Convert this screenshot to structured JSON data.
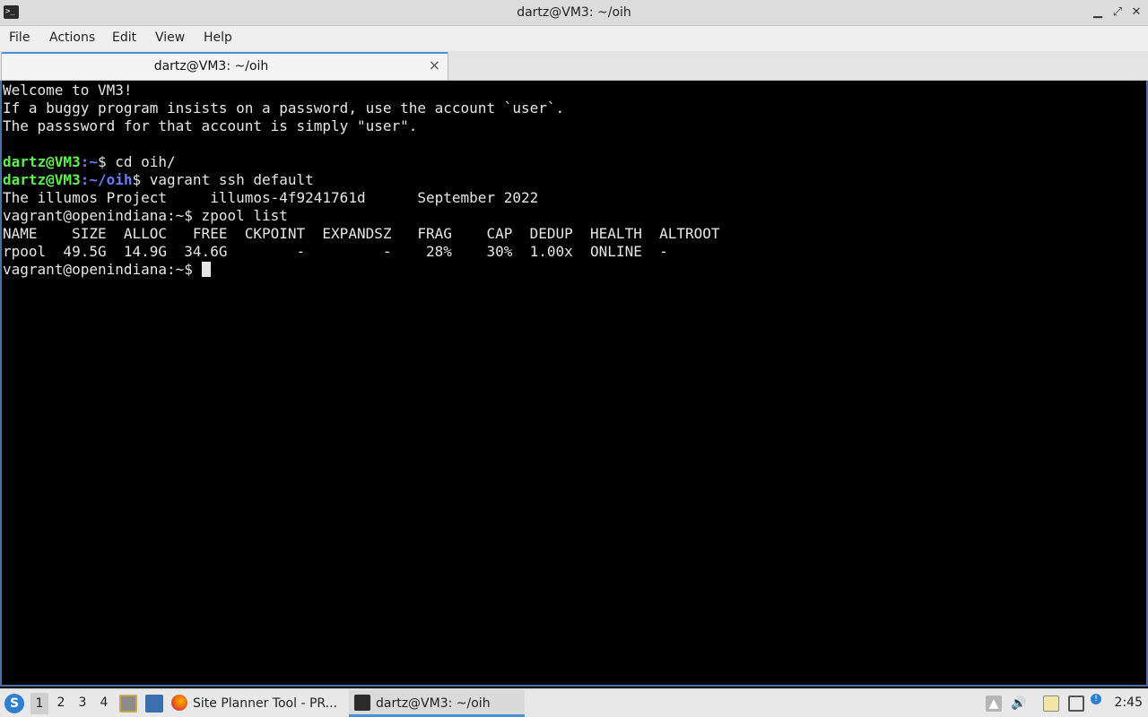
{
  "window": {
    "title": "dartz@VM3: ~/oih",
    "minimize": "▁",
    "maximize": "⤢",
    "close": "✕"
  },
  "menu": [
    "File",
    "Actions",
    "Edit",
    "View",
    "Help"
  ],
  "tab": {
    "label": "dartz@VM3: ~/oih",
    "close": "×"
  },
  "terminal": {
    "motd1": "Welcome to VM3!",
    "motd2": "If a buggy program insists on a password, use the account `user`.",
    "motd3": "The passsword for that account is simply \"user\".",
    "p1_user": "dartz@VM3",
    "p1_path": ":~",
    "p1_cmd": "$ cd oih/",
    "p2_user": "dartz@VM3",
    "p2_path": ":~/oih",
    "p2_cmd": "$ vagrant ssh default",
    "banner": "The illumos Project     illumos-4f9241761d      September 2022",
    "cmd_zpool": "vagrant@openindiana:~$ zpool list",
    "zpool_header": "NAME    SIZE  ALLOC   FREE  CKPOINT  EXPANDSZ   FRAG    CAP  DEDUP  HEALTH  ALTROOT",
    "zpool_row": "rpool  49.5G  14.9G  34.6G        -         -    28%    30%  1.00x  ONLINE  -",
    "prompt_final": "vagrant@openindiana:~$ "
  },
  "taskbar": {
    "start_icon": "start-menu-icon",
    "workspaces": [
      "1",
      "2",
      "3",
      "4"
    ],
    "tasks": [
      {
        "label": "Site Planner Tool - PR...",
        "icon": "firefox-icon"
      },
      {
        "label": "dartz@VM3: ~/oih",
        "icon": "terminal-icon"
      }
    ],
    "clock": "2:45"
  }
}
